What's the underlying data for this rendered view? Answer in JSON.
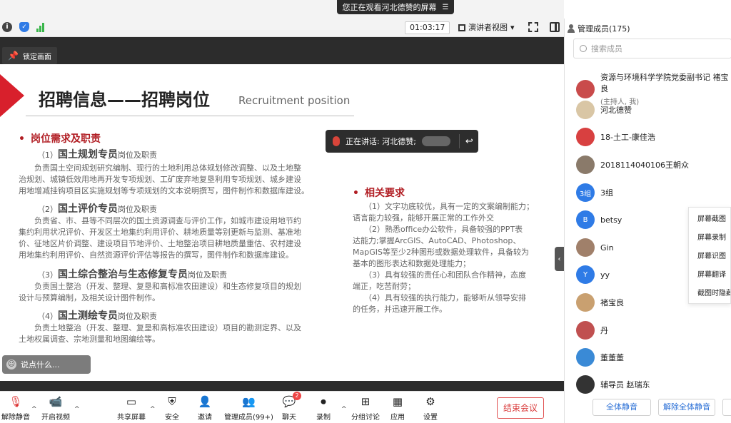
{
  "topbar": {
    "watch_banner": "您正在观看河北德赞的屏幕",
    "timer": "01:03:17",
    "view_label": "演讲者视图"
  },
  "screen": {
    "lock_label": "锁定画面",
    "speaking_label": "正在讲话: 河北德赞;",
    "chat_placeholder": "说点什么..."
  },
  "slide": {
    "title": "招聘信息——招聘岗位",
    "subtitle": "Recruitment position",
    "left_section": "岗位需求及职责",
    "jobs": [
      {
        "num": "（1）",
        "name": "国土规划专员",
        "suffix": "岗位及职责",
        "desc": [
          "负责国土空间规划研究编制、现行的土地利用总体规划修改调整、以及土地整",
          "治规划、城镇低效用地再开发专项规划、工矿废弃地复垦利用专项规划、城乡建设",
          "用地增减挂钩项目区实施规划等专项规划的文本说明撰写，图件制作和数据库建设。"
        ]
      },
      {
        "num": "（2）",
        "name": "国土评价专员",
        "suffix": "岗位及职责",
        "desc": [
          "负责省、市、县等不同层次的国土资源调查与评价工作，如城市建设用地节约",
          "集约利用状况评价、开发区土地集约利用评价、耕地质量等别更新与监测、基准地",
          "价、征地区片价调整、建设项目节地评价、土地整治项目耕地质量重估、农村建设",
          "用地集约利用评价、自然资源评价评估等报告的撰写，图件制作和数据库建设。"
        ]
      },
      {
        "num": "（3）",
        "name": "国土综合整治与生态修复专员",
        "suffix": "岗位及职责",
        "desc": [
          "负责国土整治（开发、整理、复垦和高标准农田建设）和生态修复项目的规划",
          "设计与预算编制，及相关设计图件制作。"
        ]
      },
      {
        "num": "（4）",
        "name": "国土测绘专员",
        "suffix": "岗位及职责",
        "desc": [
          "负责土地整治（开发、整理、复垦和高标准农田建设）项目的勘测定界、以及",
          "土地权属调查、宗地测量和地图编绘等。"
        ]
      }
    ],
    "right_section": "相关要求",
    "requirements": [
      "（1）文字功底较优，具有一定的文案编制能力；",
      "语言能力较强，能够开展正常的工作外交",
      "（2）熟悉office办公软件，具备较强的PPT表",
      "达能力;掌握ArcGIS、AutoCAD、Photoshop、",
      "MapGIS等至少2种图形或数据处理软件，具备较为",
      "基本的图形表达和数据处理能力；",
      "（3）具有较强的责任心和团队合作精神，态度",
      "端正，吃苦耐劳；",
      "（4）具有较强的执行能力，能够听从领导安排",
      "的任务，并迅速开展工作。"
    ]
  },
  "toolbar": {
    "items": [
      {
        "label": "解除静音",
        "icon": "mic-off-icon"
      },
      {
        "label": "开启视频",
        "icon": "video-off-icon"
      },
      {
        "label": "共享屏幕",
        "icon": "share-screen-icon"
      },
      {
        "label": "安全",
        "icon": "shield-icon"
      },
      {
        "label": "邀请",
        "icon": "invite-icon"
      },
      {
        "label": "管理成员(99+)",
        "icon": "members-icon"
      },
      {
        "label": "聊天",
        "icon": "chat-icon"
      },
      {
        "label": "录制",
        "icon": "record-icon"
      },
      {
        "label": "分组讨论",
        "icon": "breakout-icon"
      },
      {
        "label": "应用",
        "icon": "apps-icon"
      },
      {
        "label": "设置",
        "icon": "settings-icon"
      }
    ],
    "chat_badge": "2",
    "end_meeting": "结束会议"
  },
  "panel": {
    "title": "管理成员(175)",
    "search_placeholder": "搜索成员",
    "members": [
      {
        "name": "资源与环境科学学院党委副书记 褚宝良",
        "sub": "(主持人, 我)",
        "avatar_color": "#c94b4b"
      },
      {
        "name": "河北德赞",
        "sub": "",
        "avatar_color": "#d9c6a5"
      },
      {
        "name": "18-土工-康佳浩",
        "sub": "",
        "avatar_color": "#d84040"
      },
      {
        "name": "2018114040106王朝众",
        "sub": "",
        "avatar_color": "#8a7a6a"
      },
      {
        "name": "3组",
        "sub": "",
        "avatar_color": "#2f7be6",
        "avatar_text": "3组"
      },
      {
        "name": "betsy",
        "sub": "",
        "avatar_color": "#2f7be6",
        "avatar_text": "B"
      },
      {
        "name": "Gin",
        "sub": "",
        "avatar_color": "#a0806a"
      },
      {
        "name": "yy",
        "sub": "",
        "avatar_color": "#2f7be6",
        "avatar_text": "Y"
      },
      {
        "name": "褚宝良",
        "sub": "",
        "avatar_color": "#c9a070"
      },
      {
        "name": "丹",
        "sub": "",
        "avatar_color": "#c05050"
      },
      {
        "name": "董董董",
        "sub": "",
        "avatar_color": "#3a8ad6"
      },
      {
        "name": "辅导员 赵瑞东",
        "sub": "",
        "avatar_color": "#333333"
      }
    ],
    "context_menu": [
      "屏幕截图",
      "屏幕录制",
      "屏幕识图",
      "屏幕翻译",
      "截图时隐藏"
    ],
    "mute_all": "全体静音",
    "unmute_all": "解除全体静音"
  }
}
